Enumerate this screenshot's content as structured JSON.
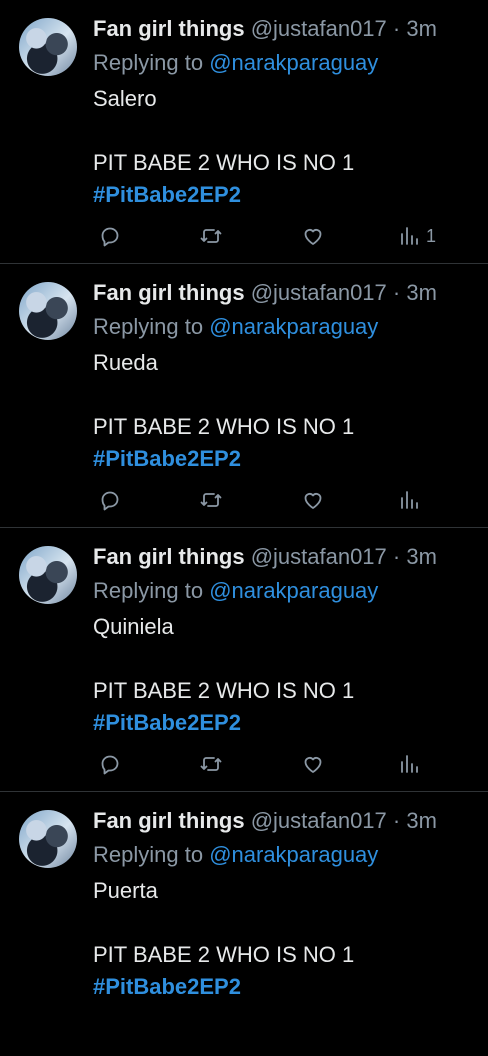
{
  "tweets": [
    {
      "name": "Fan girl things",
      "handle": "@justafan017",
      "dot": "·",
      "time": "3m",
      "replying_prefix": "Replying to ",
      "replying_to": "@narakparaguay",
      "line1": "Salero",
      "line2": "PIT BABE 2 WHO IS NO 1",
      "hashtag": "#PitBabe2EP2",
      "views": "1"
    },
    {
      "name": "Fan girl things",
      "handle": "@justafan017",
      "dot": "·",
      "time": "3m",
      "replying_prefix": "Replying to ",
      "replying_to": "@narakparaguay",
      "line1": "Rueda",
      "line2": "PIT BABE 2 WHO IS NO 1",
      "hashtag": "#PitBabe2EP2",
      "views": ""
    },
    {
      "name": "Fan girl things",
      "handle": "@justafan017",
      "dot": "·",
      "time": "3m",
      "replying_prefix": "Replying to ",
      "replying_to": "@narakparaguay",
      "line1": "Quiniela",
      "line2": "PIT BABE 2 WHO IS NO 1",
      "hashtag": "#PitBabe2EP2",
      "views": ""
    },
    {
      "name": "Fan girl things",
      "handle": "@justafan017",
      "dot": "·",
      "time": "3m",
      "replying_prefix": "Replying to ",
      "replying_to": "@narakparaguay",
      "line1": "Puerta",
      "line2": "PIT BABE 2 WHO IS NO 1",
      "hashtag": "#PitBabe2EP2",
      "views": ""
    }
  ],
  "icons": {
    "reply": "reply-icon",
    "retweet": "retweet-icon",
    "like": "heart-icon",
    "views": "views-icon"
  },
  "colors": {
    "background": "#000000",
    "text": "#e7e9ea",
    "muted": "#8b98a5",
    "link": "#2f8fde",
    "divider": "#2f3336"
  }
}
